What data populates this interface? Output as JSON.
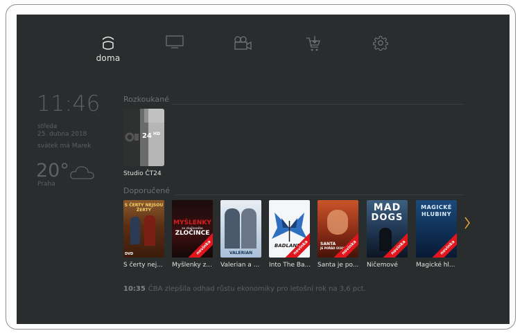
{
  "nav": {
    "items": [
      {
        "id": "home",
        "label": "doma",
        "icon": "home-icon"
      },
      {
        "id": "tv",
        "label": "",
        "icon": "tv-icon"
      },
      {
        "id": "video",
        "label": "",
        "icon": "video-camera-icon"
      },
      {
        "id": "shop",
        "label": "",
        "icon": "cart-icon"
      },
      {
        "id": "settings",
        "label": "",
        "icon": "gear-icon"
      }
    ]
  },
  "info": {
    "time": "11:46",
    "weekday": "středa",
    "date": "25. dubna 2018",
    "nameday": "svátek má Marek",
    "temperature": "20°",
    "city": "Praha"
  },
  "watched": {
    "title": "Rozkoukané",
    "items": [
      {
        "caption": "Studio ČT24",
        "logo": "24",
        "badge": "HD"
      }
    ]
  },
  "recommended": {
    "title": "Doporučené",
    "badge_label": "novinka",
    "items": [
      {
        "caption": "S čerty nej...",
        "poster_text": "S ČERTY NEJSOU ŽERTY",
        "new": false,
        "dvd": "DVD"
      },
      {
        "caption": "Myšlenky z...",
        "poster_text": "MYŠLENKY",
        "poster_sub": "ZLOČINCE",
        "poster_small": "ze zločinného",
        "new": true
      },
      {
        "caption": "Valerian a ...",
        "poster_text": "VALERIAN",
        "new": false
      },
      {
        "caption": "Into The Ba...",
        "poster_text": "BADLANDS",
        "new": true
      },
      {
        "caption": "Santa je po...",
        "poster_text": "SANTA",
        "poster_sub": "JE POŘÁD ÚCHYL",
        "new": true
      },
      {
        "caption": "Ničemové",
        "poster_text": "MAD",
        "poster_sub": "DOGS",
        "new": true
      },
      {
        "caption": "Magické hl...",
        "poster_text": "MAGICKÉ",
        "poster_sub": "HLUBINY",
        "new": true
      }
    ]
  },
  "ticker": {
    "time": "10:35",
    "text": "ČBA zlepšila odhad růstu ekonomiky pro letošní rok na 3,6 pct."
  },
  "colors": {
    "background": "#2a2d2d",
    "accent": "#e8a33c",
    "ribbon": "#e2141c"
  }
}
